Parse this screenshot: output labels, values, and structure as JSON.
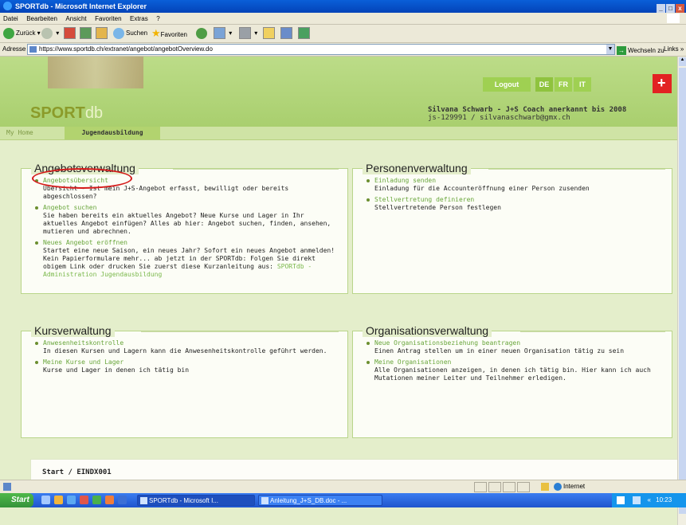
{
  "window": {
    "title": "SPORTdb - Microsoft Internet Explorer",
    "controls": [
      "_",
      "□",
      "x"
    ]
  },
  "menu": [
    "Datei",
    "Bearbeiten",
    "Ansicht",
    "Favoriten",
    "Extras",
    "?"
  ],
  "toolbar": {
    "back": "Zurück",
    "search": "Suchen",
    "favorites": "Favoriten"
  },
  "address": {
    "label": "Adresse",
    "url": "https://www.sportdb.ch/extranet/angebot/angebotOverview.do",
    "go": "Wechseln zu",
    "links": "Links »"
  },
  "header": {
    "logo_sport": "SPORT",
    "logo_db": "db",
    "logout": "Logout",
    "languages": [
      "DE",
      "FR",
      "IT"
    ],
    "user_name": "Silvana Schwarb - J+S Coach anerkannt bis 2008",
    "user_id": "js-129991 / silvanaschwarb@gmx.ch"
  },
  "nav": {
    "home": "My Home",
    "active": "Jugendausbildung"
  },
  "angebot": {
    "title": "Angebotsverwaltung",
    "items": [
      {
        "link": "Angebotsübersicht",
        "desc": "Übersicht - Ist mein J+S-Angebot erfasst, bewilligt oder bereits abgeschlossen?"
      },
      {
        "link": "Angebot suchen",
        "desc": "Sie haben bereits ein aktuelles Angebot? Neue Kurse und Lager in Ihr aktuelles Angebot einfügen? Alles ab hier: Angebot suchen, finden, ansehen, mutieren und abrechnen."
      },
      {
        "link": "Neues Angebot eröffnen",
        "desc": "Startet eine neue Saison, ein neues Jahr? Sofort ein neues Angebot anmelden! Kein Papierformulare mehr... ab jetzt in der SPORTdb: Folgen Sie direkt obigem Link oder drucken Sie zuerst diese Kurzanleitung aus:",
        "download": "SPORTdb - Administration Jugendausbildung"
      }
    ]
  },
  "personen": {
    "title": "Personenverwaltung",
    "items": [
      {
        "link": "Einladung senden",
        "desc": "Einladung für die Accounteröffnung einer Person zusenden"
      },
      {
        "link": "Stellvertretung definieren",
        "desc": "Stellvertretende Person festlegen"
      }
    ]
  },
  "kurs": {
    "title": "Kursverwaltung",
    "items": [
      {
        "link": "Anwesenheitskontrolle",
        "desc": "In diesen Kursen und Lagern kann die Anwesenheitskontrolle geführt werden."
      },
      {
        "link": "Meine Kurse und Lager",
        "desc": "Kurse und Lager in denen ich tätig bin"
      }
    ]
  },
  "org": {
    "title": "Organisationsverwaltung",
    "items": [
      {
        "link": "Neue Organisationsbeziehung beantragen",
        "desc": "Einen Antrag stellen um in einer neuen Organisation tätig zu sein"
      },
      {
        "link": "Meine Organisationen",
        "desc": "Alle Organisationen anzeigen, in denen ich tätig bin. Hier kann ich auch Mutationen meiner Leiter und Teilnehmer erledigen."
      }
    ]
  },
  "footer": {
    "text": "Start / EINDX001"
  },
  "status": {
    "zone": "Internet"
  },
  "taskbar": {
    "start": "Start",
    "tasks": [
      "SPORTdb - Microsoft I...",
      "Anleitung_J+S_DB.doc - ..."
    ],
    "time": "10:23"
  }
}
